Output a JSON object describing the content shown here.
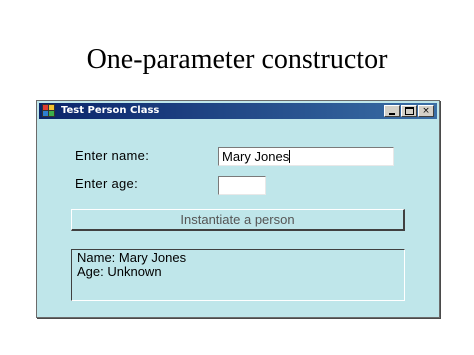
{
  "slide": {
    "title": "One-parameter constructor"
  },
  "window": {
    "title": "Test Person Class",
    "controls": {
      "minimize": "",
      "maximize": "",
      "close": "×"
    }
  },
  "form": {
    "name_label": "Enter name:",
    "name_value": "Mary Jones",
    "age_label": "Enter age:",
    "age_value": "",
    "button_label": "Instantiate a person",
    "output_line1": "Name: Mary Jones",
    "output_line2": "Age: Unknown"
  },
  "colors": {
    "window_bg": "#bfe6ea",
    "titlebar_start": "#0a246a",
    "titlebar_end": "#3a6ea5"
  }
}
